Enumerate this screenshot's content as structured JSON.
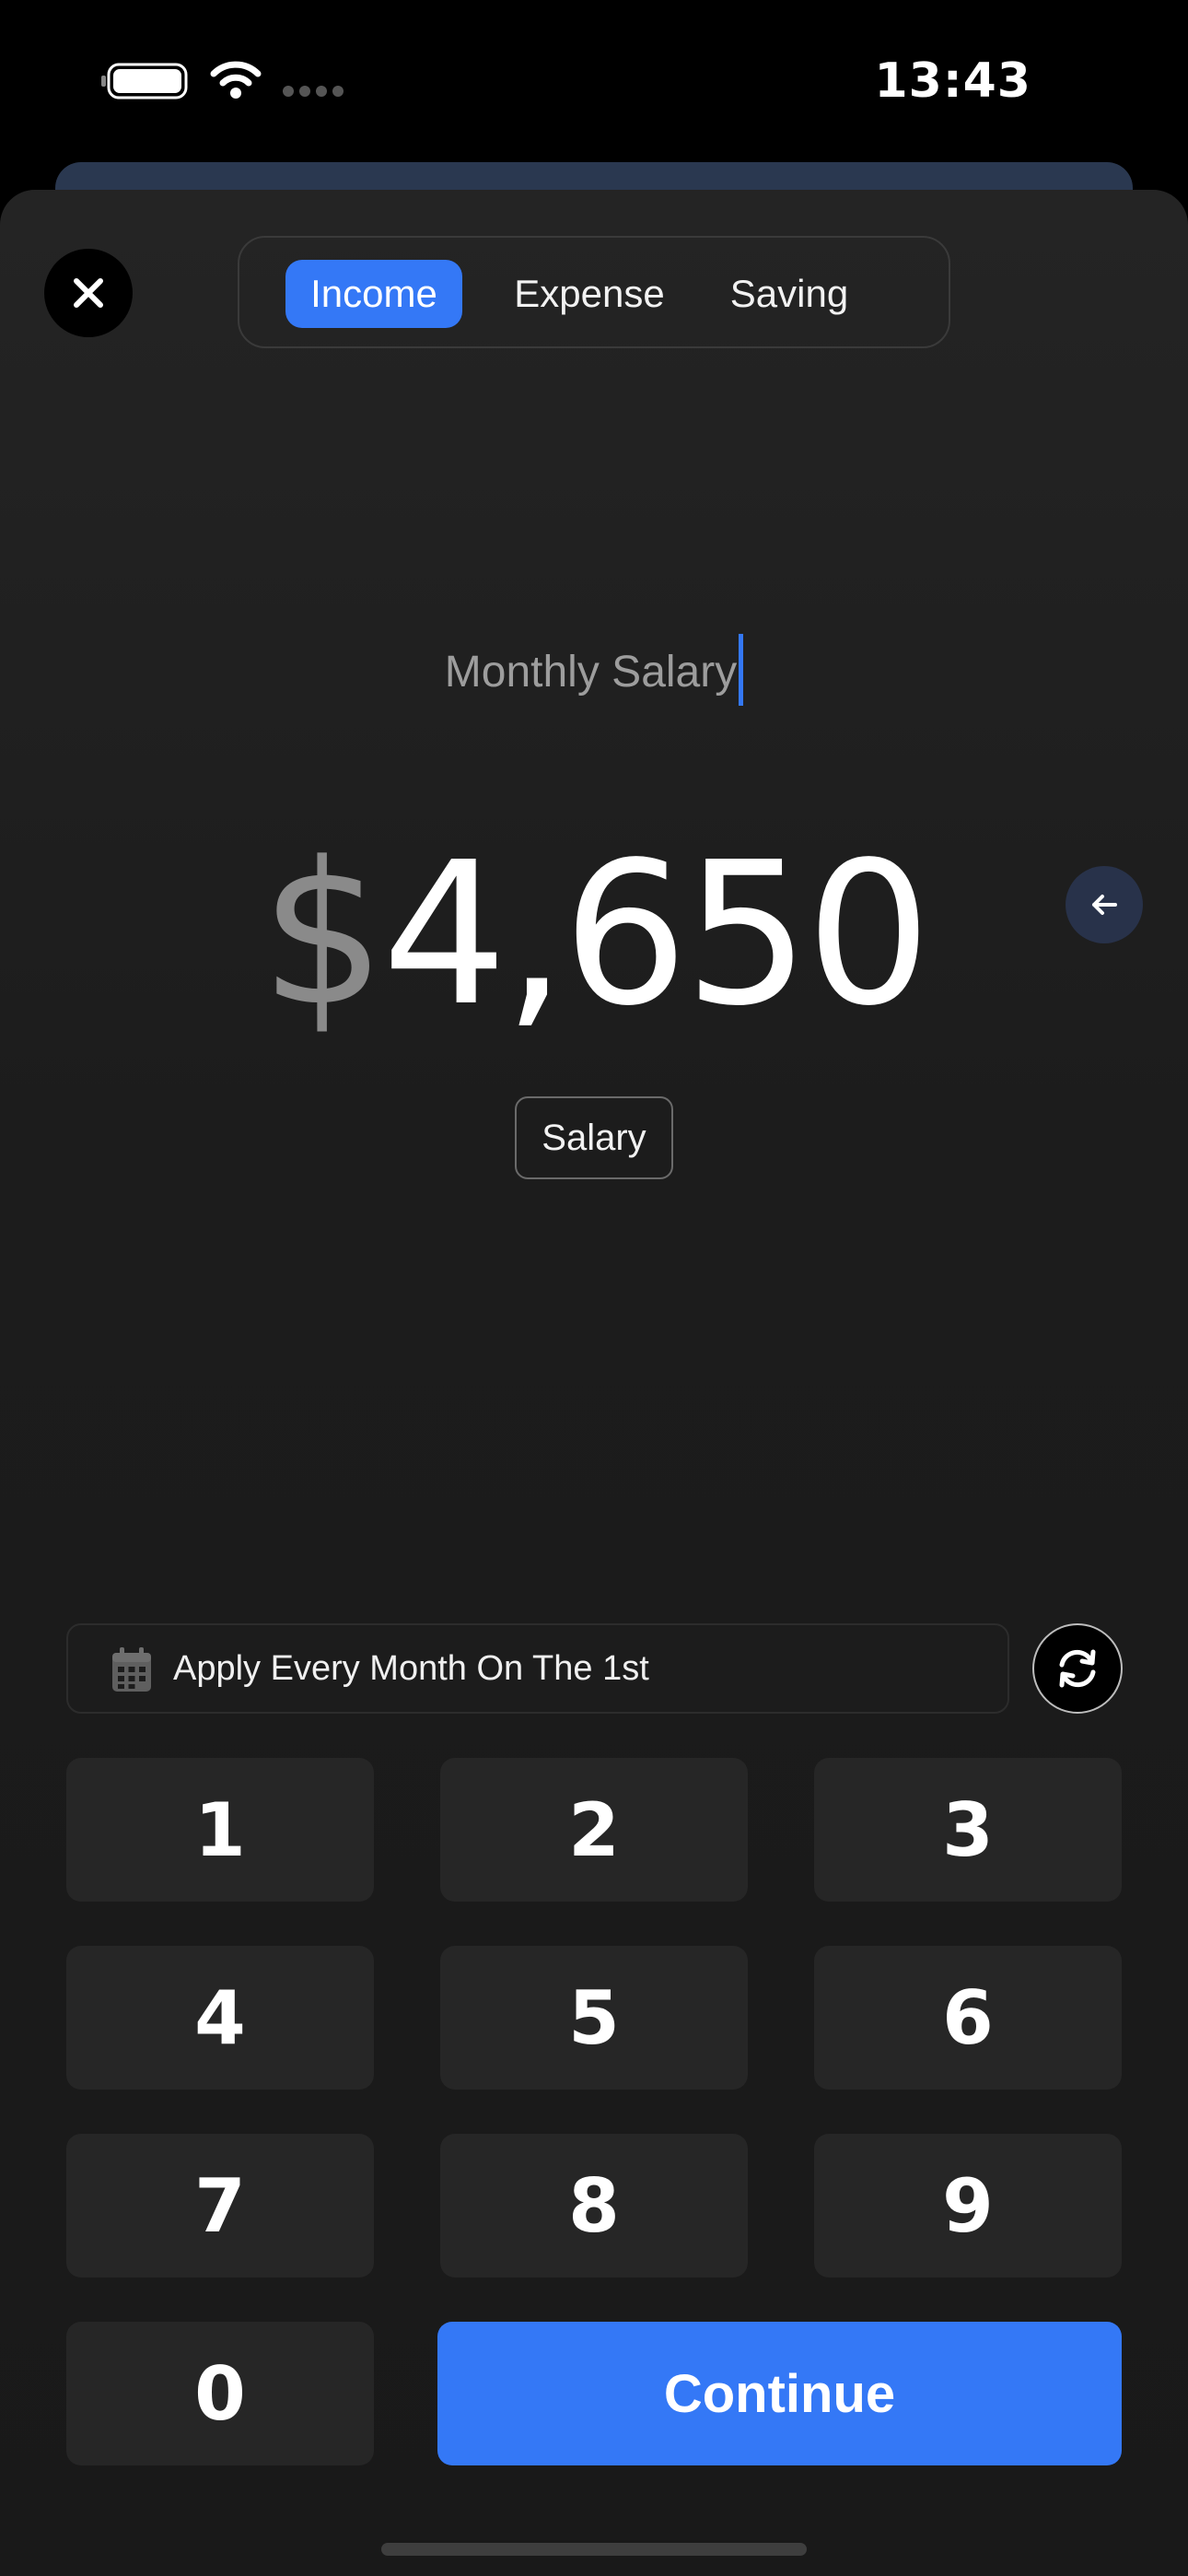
{
  "status_bar": {
    "time": "13:43"
  },
  "tabs": [
    {
      "label": "Income",
      "active": true
    },
    {
      "label": "Expense",
      "active": false
    },
    {
      "label": "Saving",
      "active": false
    }
  ],
  "entry": {
    "title_value": "Monthly Salary",
    "currency_symbol": "$",
    "amount": "4,650",
    "category": "Salary"
  },
  "schedule": {
    "label": "Apply Every Month On The 1st"
  },
  "keypad": {
    "keys": [
      "1",
      "2",
      "3",
      "4",
      "5",
      "6",
      "7",
      "8",
      "9",
      "0"
    ],
    "continue_label": "Continue"
  },
  "colors": {
    "accent": "#3478f6",
    "background": "#1c1c1c",
    "key_background": "#262626"
  },
  "icons": [
    "battery-icon",
    "wifi-icon",
    "close-icon",
    "arrow-left-icon",
    "calendar-icon",
    "refresh-icon"
  ]
}
